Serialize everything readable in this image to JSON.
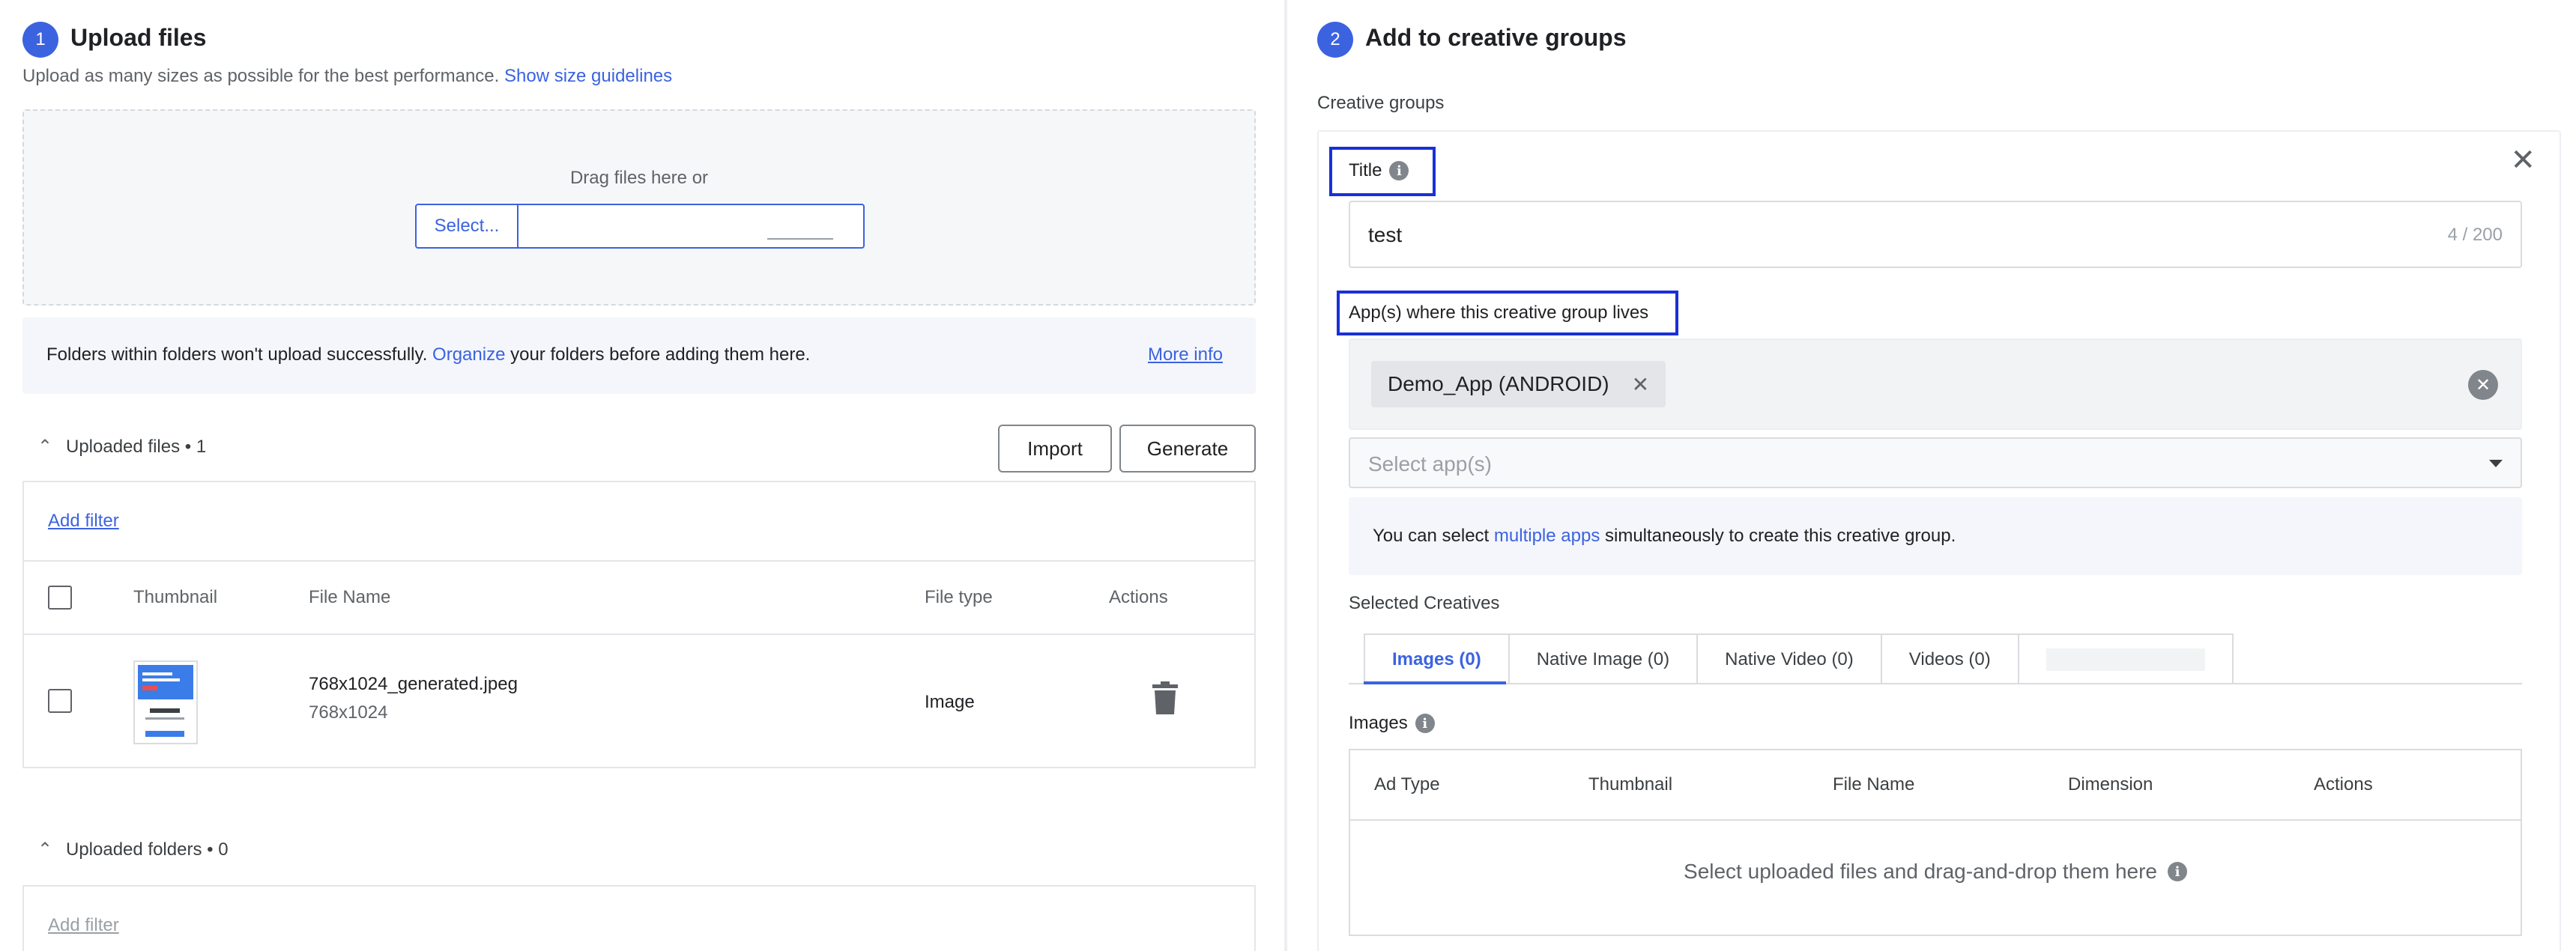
{
  "upload": {
    "step_number": "1",
    "title": "Upload files",
    "subtitle": "Upload as many sizes as possible for the best performance.",
    "guidelines_link": "Show size guidelines",
    "drag_text": "Drag files here or",
    "select_button": "Select...",
    "info_text_before": "Folders within folders won't upload successfully.",
    "info_link": "Organize",
    "info_text_after": "your folders before adding them here.",
    "more_info": "More info"
  },
  "uploaded_files": {
    "heading": "Uploaded files • 1",
    "import_button": "Import",
    "generate_button": "Generate",
    "add_filter": "Add filter",
    "columns": [
      "Thumbnail",
      "File Name",
      "File type",
      "Actions"
    ],
    "rows": [
      {
        "file_name": "768x1024_generated.jpeg",
        "dimensions": "768x1024",
        "file_type": "Image"
      }
    ]
  },
  "uploaded_folders": {
    "heading": "Uploaded folders • 0",
    "add_filter": "Add filter"
  },
  "groups": {
    "step_number": "2",
    "title": "Add to creative groups",
    "section_label": "Creative groups",
    "title_label": "Title",
    "title_value": "test",
    "title_count": "4 / 200",
    "apps_label": "App(s) where this creative group lives",
    "app_chip": "Demo_App (ANDROID)",
    "select_apps_placeholder": "Select app(s)",
    "hint_before": "You can select",
    "hint_link": "multiple apps",
    "hint_after": "simultaneously to create this creative group.",
    "selected_creatives": "Selected Creatives",
    "tabs": [
      "Images (0)",
      "Native Image (0)",
      "Native Video (0)",
      "Videos (0)"
    ],
    "images_label": "Images",
    "images_columns": [
      "Ad Type",
      "Thumbnail",
      "File Name",
      "Dimension",
      "Actions"
    ],
    "empty_message": "Select uploaded files and drag-and-drop them here"
  },
  "colors": {
    "accent": "#3b63e0",
    "highlight": "#1a2fd8"
  }
}
